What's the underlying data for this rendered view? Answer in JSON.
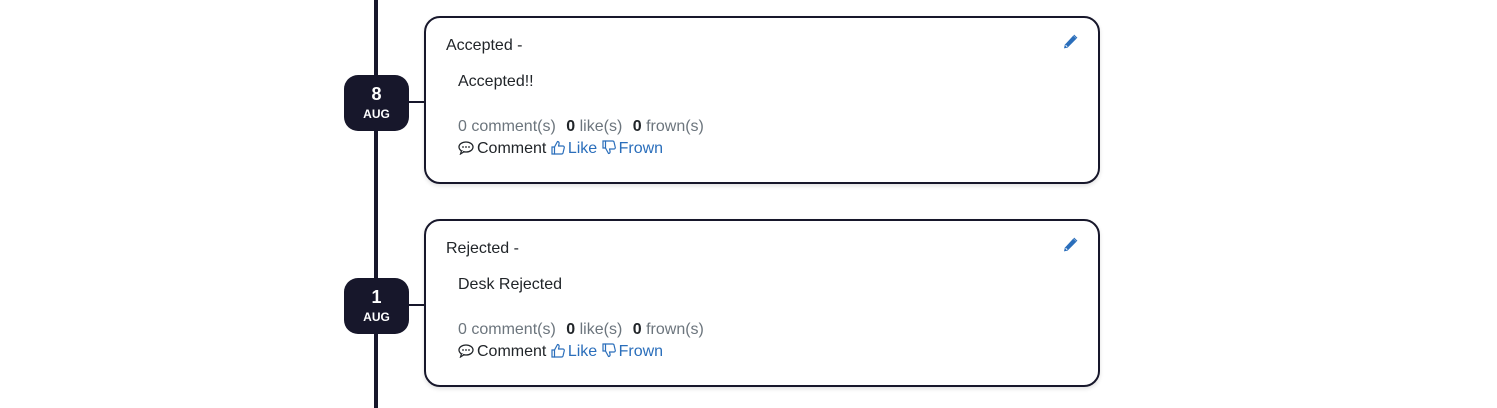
{
  "entries": [
    {
      "day": "8",
      "month": "AUG",
      "title": "Accepted -",
      "body": "Accepted!!",
      "comments_text": "0 comment(s)",
      "likes_count": "0",
      "likes_text": "like(s)",
      "frowns_count": "0",
      "frowns_text": "frown(s)",
      "comment_label": "Comment",
      "like_label": "Like",
      "frown_label": "Frown"
    },
    {
      "day": "1",
      "month": "AUG",
      "title": "Rejected -",
      "body": "Desk Rejected",
      "comments_text": "0 comment(s)",
      "likes_count": "0",
      "likes_text": "like(s)",
      "frowns_count": "0",
      "frowns_text": "frown(s)",
      "comment_label": "Comment",
      "like_label": "Like",
      "frown_label": "Frown"
    }
  ],
  "colors": {
    "timeline": "#17172b",
    "link": "#2a6ebb",
    "muted": "#6c757d"
  },
  "icons": {
    "edit": "pencil-icon",
    "comment": "speech-bubble-icon",
    "like": "thumbs-up-icon",
    "frown": "thumbs-down-icon"
  }
}
